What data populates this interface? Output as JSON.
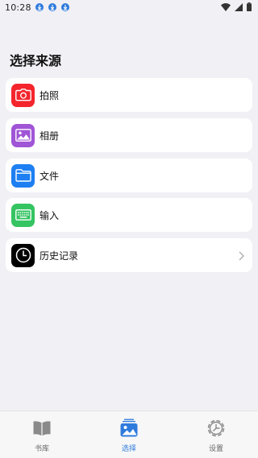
{
  "status_bar": {
    "time": "10:28"
  },
  "page": {
    "title": "选择来源"
  },
  "sources": [
    {
      "label": "拍照",
      "icon": "camera-icon",
      "color": "#f4252c"
    },
    {
      "label": "相册",
      "icon": "photo-album-icon",
      "color": "#a055d6"
    },
    {
      "label": "文件",
      "icon": "folder-icon",
      "color": "#1d7ff2"
    },
    {
      "label": "输入",
      "icon": "keyboard-icon",
      "color": "#35c462"
    },
    {
      "label": "历史记录",
      "icon": "clock-icon",
      "color": "#000000"
    }
  ],
  "tab_bar": {
    "tabs": [
      {
        "label": "书库",
        "icon": "book-icon",
        "active": false
      },
      {
        "label": "选择",
        "icon": "gallery-icon",
        "active": true
      },
      {
        "label": "设置",
        "icon": "gear-icon",
        "active": false
      }
    ]
  },
  "colors": {
    "accent": "#2f7bdc",
    "background": "#f1f0f5"
  }
}
